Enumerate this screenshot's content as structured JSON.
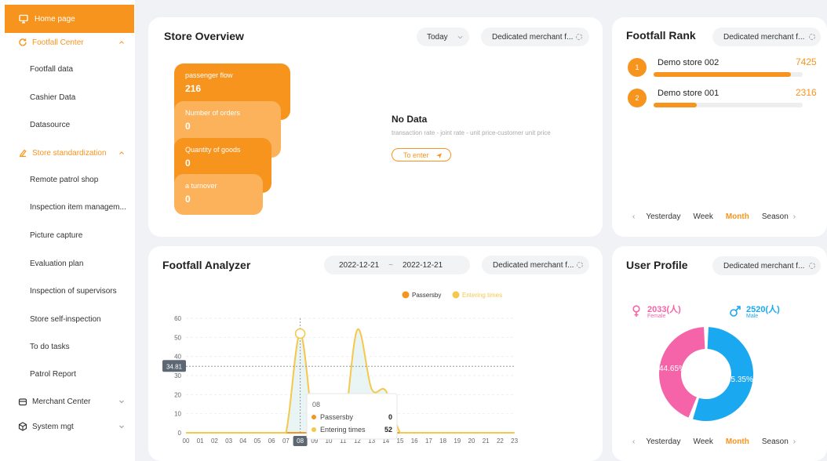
{
  "sidebar": {
    "home": "Home page",
    "footfall_center": "Footfall Center",
    "footfall_items": [
      "Footfall data",
      "Cashier Data",
      "Datasource"
    ],
    "store_std": "Store standardization",
    "std_items": [
      "Remote patrol shop",
      "Inspection item managem...",
      "Picture capture",
      "Evaluation plan",
      "Inspection of supervisors",
      "Store self-inspection",
      "To do tasks",
      "Patrol Report"
    ],
    "merchant_center": "Merchant Center",
    "system_mgt": "System mgt"
  },
  "overview": {
    "title": "Store Overview",
    "period": "Today",
    "merchant": "Dedicated merchant f...",
    "stats": [
      {
        "label": "passenger flow",
        "value": "216"
      },
      {
        "label": "Number of orders",
        "value": "0"
      },
      {
        "label": "Quantity of goods",
        "value": "0"
      },
      {
        "label": "a turnover",
        "value": "0"
      }
    ],
    "no_data": "No Data",
    "no_data_sub": "transaction rate - joint rate - unit price-customer unit price",
    "enter": "To enter"
  },
  "rank": {
    "title": "Footfall Rank",
    "merchant": "Dedicated merchant f...",
    "items": [
      {
        "no": "1",
        "name": "Demo store 002",
        "value": "7425",
        "ratio": 0.92
      },
      {
        "no": "2",
        "name": "Demo store 001",
        "value": "2316",
        "ratio": 0.29
      }
    ],
    "tabs": [
      "Yesterday",
      "Week",
      "Month",
      "Season"
    ],
    "active_tab": "Month"
  },
  "analyzer": {
    "title": "Footfall Analyzer",
    "date_from": "2022-12-21",
    "sep": "~",
    "date_to": "2022-12-21",
    "merchant": "Dedicated merchant f..."
  },
  "chart_data": {
    "type": "line",
    "x": [
      "00",
      "01",
      "02",
      "03",
      "04",
      "05",
      "06",
      "07",
      "08",
      "09",
      "10",
      "11",
      "12",
      "13",
      "14",
      "15",
      "16",
      "17",
      "18",
      "19",
      "20",
      "21",
      "22",
      "23"
    ],
    "ylim": [
      0,
      60
    ],
    "yticks": [
      "0",
      "10",
      "20",
      "30",
      "40",
      "50",
      "60"
    ],
    "series": [
      {
        "name": "Passersby",
        "values": [
          0,
          0,
          0,
          0,
          0,
          0,
          0,
          0,
          0,
          0,
          0,
          0,
          0,
          0,
          0,
          0,
          0,
          0,
          0,
          0,
          0,
          0,
          0,
          0
        ]
      },
      {
        "name": "Entering times",
        "values": [
          0,
          0,
          0,
          0,
          0,
          0,
          0,
          0,
          52,
          0,
          0,
          0,
          54,
          23,
          22,
          0,
          0,
          0,
          0,
          0,
          0,
          0,
          0,
          0
        ]
      }
    ],
    "colors": {
      "Passersby": "#f7941d",
      "Entering times": "#f5c84b"
    },
    "tooltip": {
      "title": "08",
      "rows": [
        {
          "name": "Passersby",
          "value": "0"
        },
        {
          "name": "Entering times",
          "value": "52"
        }
      ]
    },
    "crosshair_x": "08",
    "crosshair_y": "34.81",
    "legend_position": "top-right"
  },
  "profile": {
    "title": "User Profile",
    "merchant": "Dedicated merchant f...",
    "female_count": "2033(人)",
    "female_label": "Female",
    "male_count": "2520(人)",
    "male_label": "Male",
    "female_pct": "44.65%",
    "male_pct": "55.35%",
    "female_ratio": 0.4465,
    "female_color": "#f564a9",
    "male_color": "#1aa8f0",
    "tabs": [
      "Yesterday",
      "Week",
      "Month",
      "Season"
    ],
    "active_tab": "Month"
  }
}
